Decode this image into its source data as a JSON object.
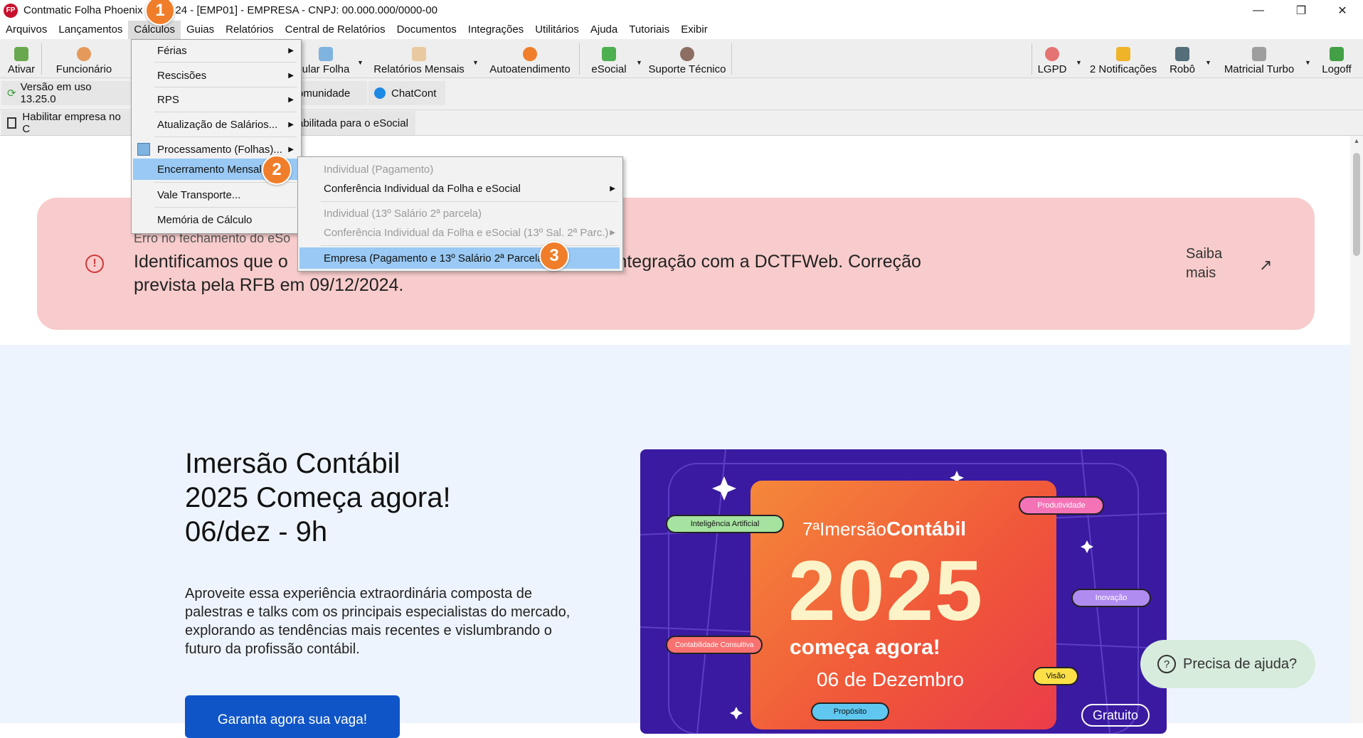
{
  "window": {
    "title": "Contmatic Folha Phoenix 0... 2024 - [EMP01] - EMPRESA - CNPJ: 00.000.000/0000-00",
    "logo": "FP",
    "minimize": "—",
    "restore": "❐",
    "close": "✕"
  },
  "menubar": [
    "Arquivos",
    "Lançamentos",
    "Cálculos",
    "Guias",
    "Relatórios",
    "Central de Relatórios",
    "Documentos",
    "Integrações",
    "Utilitários",
    "Ajuda",
    "Tutoriais",
    "Exibir"
  ],
  "toolbar": {
    "ativar": "Ativar",
    "funcionario": "Funcionário",
    "calcular_folha": "ular Folha",
    "relatorios_mensais": "Relatórios Mensais",
    "autoatendimento": "Autoatendimento",
    "esocial": "eSocial",
    "suporte": "Suporte Técnico",
    "lgpd": "LGPD",
    "notificacoes": "2 Notificações",
    "robo": "Robô",
    "matricial": "Matricial Turbo",
    "logoff": "Logoff"
  },
  "bar2": {
    "versao": "Versão em uso 13.25.0",
    "comunidade": "omunidade",
    "chatcont": "ChatCont"
  },
  "bar3": {
    "habilitar": "Habilitar empresa no C",
    "habilitada": "abilitada para o eSocial"
  },
  "alert": {
    "title": "Erro no fechamento do eSo",
    "body_left": "Identificamos que o",
    "body_right": "nto do eSocial e a integração com a DCTFWeb. Correção",
    "body_line2": "prevista pela RFB em 09/12/2024.",
    "saiba": "Saiba mais",
    "arrow": "↗"
  },
  "hero": {
    "line1": "Imersão Contábil",
    "line2": "2025 Começa agora!",
    "line3": "06/dez - 9h",
    "paragraph": "Aproveite essa experiência extraordinária composta de palestras e talks com os principais especialistas do mercado, explorando as tendências mais recentes e vislumbrando o futuro da profissão contábil.",
    "button": "Garanta agora sua vaga!"
  },
  "promo": {
    "edition": "7ª",
    "imersao": "Imersão",
    "contabil": "Contábil",
    "year": "2025",
    "comeca": "começa agora!",
    "date": "06 de Dezembro",
    "gratuito": "Gratuito",
    "tags": {
      "ia": "Inteligência Artificial",
      "prod": "Produtividade",
      "inov": "Inovação",
      "consult": "Contabilidade Consultiva",
      "visao": "Visão",
      "prop": "Propósito"
    }
  },
  "help": {
    "label": "Precisa de ajuda?"
  },
  "calc_menu": [
    "Férias",
    "Rescisões",
    "RPS",
    "Atualização de Salários...",
    "Processamento (Folhas)...",
    "Encerramento Mensal",
    "Vale Transporte...",
    "Memória de Cálculo"
  ],
  "sub_menu": [
    "Individual (Pagamento)",
    "Conferência Individual da Folha e eSocial",
    "Individual (13º Salário 2ª parcela)",
    "Conferência Individual da Folha e eSocial (13º Sal. 2ª Parc.)",
    "Empresa (Pagamento e 13º Salário 2ª Parcela)"
  ],
  "badges": [
    "1",
    "2",
    "3"
  ],
  "colors": {
    "accent": "#99c9f4",
    "badge": "#f07d2a",
    "alert_bg": "#f8cccc",
    "button": "#0f55c7"
  }
}
